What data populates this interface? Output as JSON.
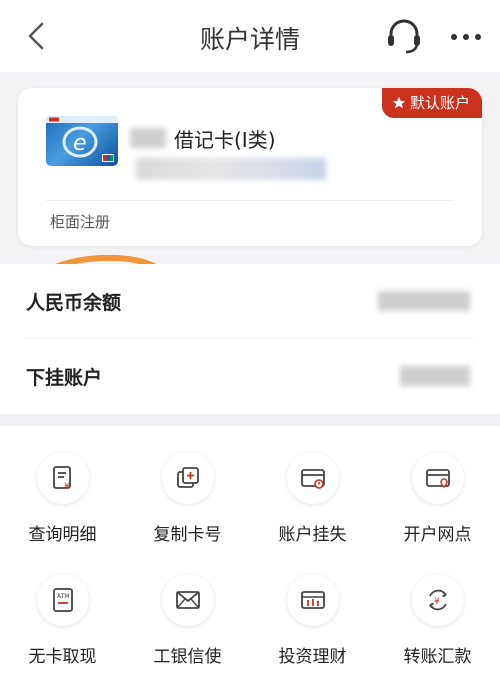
{
  "header": {
    "title": "账户详情"
  },
  "card": {
    "badge": "默认账户",
    "name": "借记卡(I类)",
    "registration": "柜面注册"
  },
  "rows": [
    {
      "label": "人民币余额"
    },
    {
      "label": "下挂账户"
    }
  ],
  "grid": [
    {
      "label": "查询明细",
      "icon": "statement-icon"
    },
    {
      "label": "复制卡号",
      "icon": "copy-card-icon"
    },
    {
      "label": "账户挂失",
      "icon": "report-loss-icon"
    },
    {
      "label": "开户网点",
      "icon": "branch-location-icon"
    },
    {
      "label": "无卡取现",
      "icon": "atm-icon"
    },
    {
      "label": "工银信使",
      "icon": "envelope-icon"
    },
    {
      "label": "投资理财",
      "icon": "investment-icon"
    },
    {
      "label": "转账汇款",
      "icon": "transfer-icon"
    }
  ],
  "colors": {
    "accent": "#c8321e",
    "annotation": "#f0953a"
  }
}
